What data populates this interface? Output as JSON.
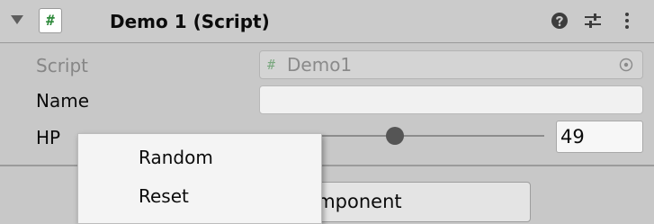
{
  "component": {
    "title": "Demo 1 (Script)",
    "script_icon_glyph": "#",
    "icons": [
      "help-icon",
      "presets-icon",
      "kebab-menu-icon"
    ]
  },
  "fields": {
    "script_label": "Script",
    "script_value": "Demo1",
    "name_label": "Name",
    "name_value": "",
    "hp_label": "HP",
    "hp_value": "49",
    "hp_slider_fraction": 0.35
  },
  "add_component_button": {
    "label": "Add Component"
  },
  "context_menu": {
    "items": [
      "Random",
      "Reset"
    ]
  },
  "colors": {
    "panel_bg": "#c8c8c8",
    "script_icon_green": "#2f8a3c"
  }
}
